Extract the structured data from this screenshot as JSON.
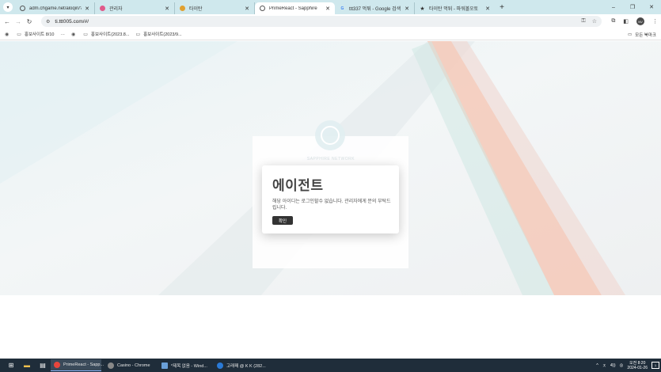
{
  "browser": {
    "tabs": [
      {
        "title": "adm.chgame.net/aloqin/?qrsc",
        "favicon_color": "#555555",
        "active": false
      },
      {
        "title": "관리자",
        "favicon_color": "#e05a8a",
        "active": false
      },
      {
        "title": "타이탄",
        "favicon_color": "#e0a030",
        "active": false
      },
      {
        "title": "PrimeReact - Sapphire",
        "favicon_color": "#555555",
        "active": true
      },
      {
        "title": "ttt337 먹튀 - Google 검색",
        "favicon_color": "#4285f4",
        "active": false
      },
      {
        "title": "타이탄 먹튀 - 파워볼오토",
        "favicon_color": "#333333",
        "active": false
      }
    ],
    "new_tab_label": "+",
    "url": "ti.ttt005.com/#/",
    "bookmarks": [
      {
        "label": "홍보사이트 8/10"
      },
      {
        "label": "…"
      },
      {
        "label": "홍보사이트(2023.8..."
      },
      {
        "label": "홍보사이트(2023/9..."
      }
    ],
    "all_bookmarks_label": "모든 북마크",
    "profile_initials": "NV"
  },
  "page": {
    "logo_text": "SAPPHIRE NETWORK",
    "dialog": {
      "title": "에이전트",
      "message": "해당 아이디는 로그인할수 없습니다. 관리자에게 문의 부탁드립니다.",
      "confirm_label": "확인"
    }
  },
  "taskbar": {
    "tasks": [
      {
        "label": "PrimeReact - Sapp...",
        "icon_color": "#e8453c",
        "active": true
      },
      {
        "label": "Casino - Chrome",
        "icon_color": "#888888",
        "active": false
      },
      {
        "label": "*제목 없음 - Wind...",
        "icon_color": "#6aa0d8",
        "active": false
      },
      {
        "label": "고래패 @ K K (282...",
        "icon_color": "#2a7ad6",
        "active": false
      }
    ],
    "tray_lang": "ㅈ",
    "tray_ime": "4))",
    "clock_time": "오전 8:20",
    "clock_date": "2024-01-26",
    "notification_count": "1"
  }
}
